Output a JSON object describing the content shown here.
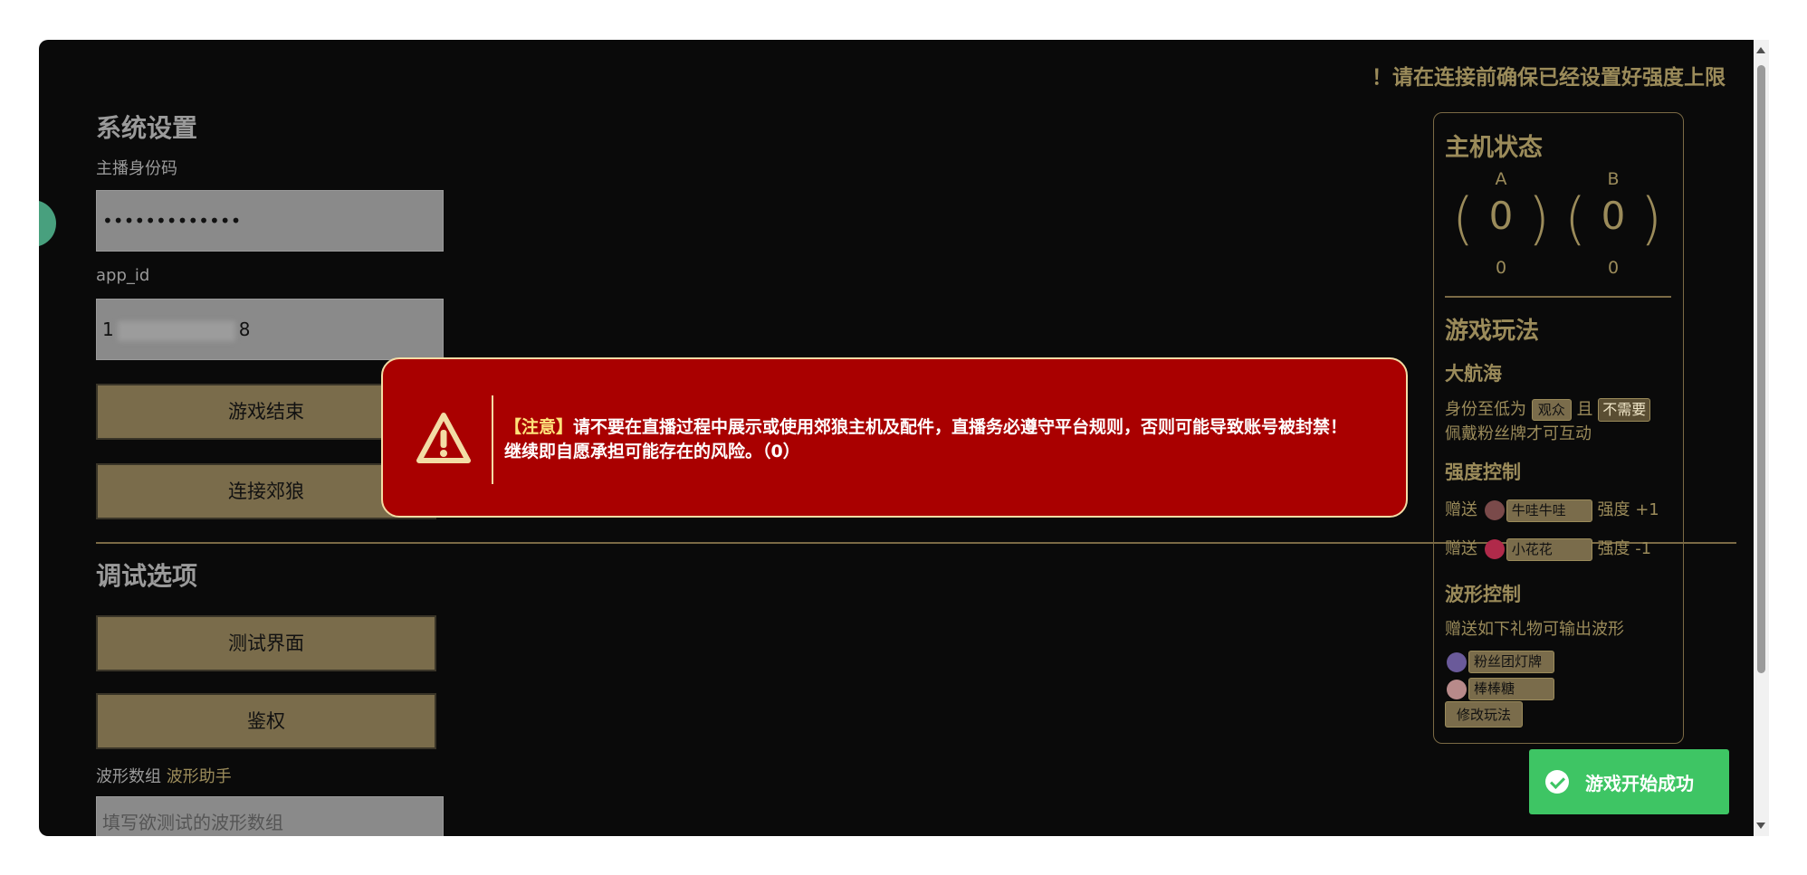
{
  "top_warning": "！请在连接前确保已经设置好强度上限",
  "system": {
    "heading": "系统设置",
    "anchor_id_label": "主播身份码",
    "anchor_id_value": "•••••••••••••",
    "app_id_label": "app_id",
    "app_id_prefix": "1",
    "app_id_suffix": "8",
    "end_game_button": "游戏结束",
    "connect_button": "连接郊狼"
  },
  "debug": {
    "heading": "调试选项",
    "test_ui_button": "测试界面",
    "auth_button": "鉴权",
    "wave_label": "波形数组",
    "wave_helper_link": "波形助手",
    "wave_placeholder": "填写欲测试的波形数组"
  },
  "host_status": {
    "title": "主机状态",
    "channel_a": {
      "label": "A",
      "value": "0",
      "sub": "0"
    },
    "channel_b": {
      "label": "B",
      "value": "0",
      "sub": "0"
    }
  },
  "gameplay": {
    "title": "游戏玩法",
    "mode_name": "大航海",
    "identity_prefix": "身份至低为",
    "identity_value": "观众",
    "and_text": "且",
    "medal_value": "不需要",
    "medal_text": "佩戴粉丝牌才可互动",
    "strength_title": "强度控制",
    "gift_give": "赠送",
    "gift_up_name": "牛哇牛哇",
    "gift_up_effect": "强度 +1",
    "gift_down_name": "小花花",
    "gift_down_effect": "强度 -1",
    "wave_title": "波形控制",
    "wave_desc": "赠送如下礼物可输出波形",
    "wave_gift_1": "粉丝团灯牌",
    "wave_gift_2": "棒棒糖",
    "edit_button": "修改玩法"
  },
  "modal": {
    "tag": "【注意】",
    "message": "请不要在直播过程中展示或使用郊狼主机及配件，直播务必遵守平台规则，否则可能导致账号被封禁！继续即自愿承担可能存在的风险。（0）"
  },
  "toast": {
    "message": "游戏开始成功",
    "color": "#3ec564"
  },
  "colors": {
    "background": "#0a0a0a",
    "accent": "#9b8b5a",
    "modal": "#a90000"
  }
}
